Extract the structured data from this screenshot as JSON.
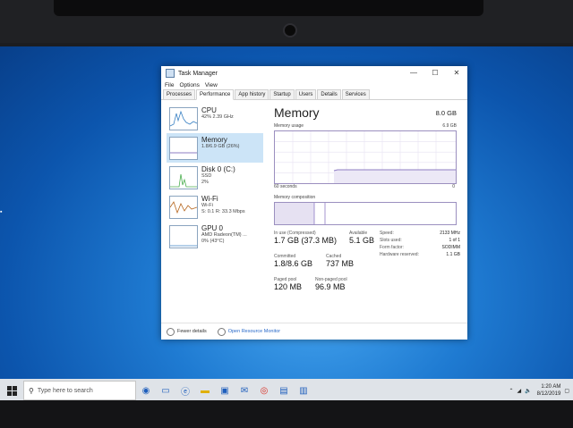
{
  "window": {
    "title": "Task Manager",
    "controls": [
      "—",
      "☐",
      "✕"
    ]
  },
  "menu": [
    "File",
    "Options",
    "View"
  ],
  "tabs": [
    "Processes",
    "Performance",
    "App history",
    "Startup",
    "Users",
    "Details",
    "Services"
  ],
  "active_tab": "Performance",
  "sidebar": [
    {
      "name": "CPU",
      "sub1": "42%  2.39 GHz",
      "sub2": ""
    },
    {
      "name": "Memory",
      "sub1": "1.8/6.9 GB (26%)",
      "sub2": ""
    },
    {
      "name": "Disk 0 (C:)",
      "sub1": "SSD",
      "sub2": "2%"
    },
    {
      "name": "Wi-Fi",
      "sub1": "Wi-Fi",
      "sub2": "S: 0.1  R: 33.3 Mbps"
    },
    {
      "name": "GPU 0",
      "sub1": "AMD Radeon(TM) ...",
      "sub2": "0%  (43°C)"
    }
  ],
  "memory": {
    "title": "Memory",
    "total": "8.0 GB",
    "usage_label": "Memory usage",
    "usage_max": "6.9 GB",
    "time_span": "60 seconds",
    "zero": "0",
    "composition_label": "Memory composition",
    "in_use_label": "In use (Compressed)",
    "in_use_value": "1.7 GB (37.3 MB)",
    "available_label": "Available",
    "available_value": "5.1 GB",
    "committed_label": "Committed",
    "committed_value": "1.8/8.6 GB",
    "cached_label": "Cached",
    "cached_value": "737 MB",
    "paged_label": "Paged pool",
    "paged_value": "120 MB",
    "nonpaged_label": "Non-paged pool",
    "nonpaged_value": "96.9 MB",
    "details": [
      {
        "k": "Speed:",
        "v": "2133 MHz"
      },
      {
        "k": "Slots used:",
        "v": "1 of 1"
      },
      {
        "k": "Form factor:",
        "v": "SODIMM"
      },
      {
        "k": "Hardware reserved:",
        "v": "1.1 GB"
      }
    ]
  },
  "footer": {
    "fewer_details": "Fewer details",
    "open_monitor": "Open Resource Monitor"
  },
  "taskbar": {
    "search_placeholder": "Type here to search",
    "time": "1:20 AM",
    "date": "8/12/2019"
  },
  "colors": {
    "accent": "#cce4f7",
    "graph_line": "#8e7cc3",
    "desktop": "#1f7bd2"
  }
}
